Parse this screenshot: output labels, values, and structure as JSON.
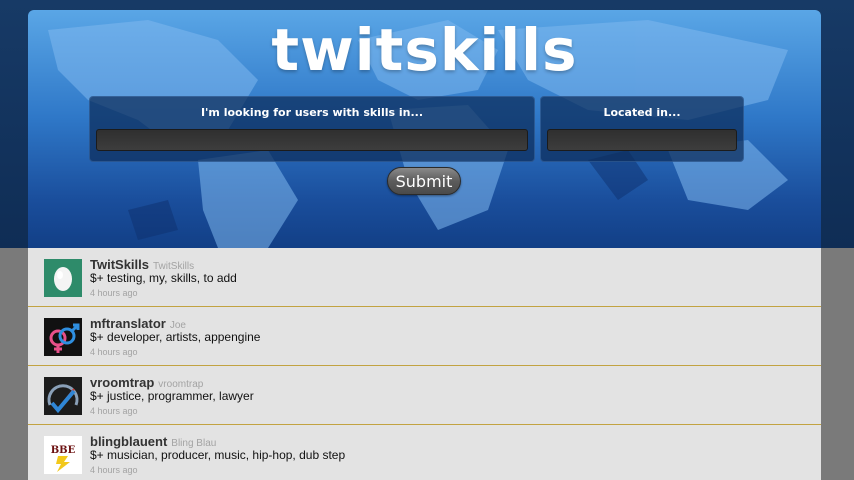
{
  "app": {
    "logo": "twitskills"
  },
  "search": {
    "skills_label": "I'm looking for users with skills in...",
    "skills_value": "",
    "location_label": "Located in...",
    "location_value": "",
    "submit_label": "Submit"
  },
  "feed": [
    {
      "username": "TwitSkills",
      "realname": "TwitSkills",
      "skills": "$+ testing, my, skills, to add",
      "time": "4 hours ago",
      "avatar": "egg-avatar-icon"
    },
    {
      "username": "mftranslator",
      "realname": "Joe",
      "skills": "$+ developer, artists, appengine",
      "time": "4 hours ago",
      "avatar": "gender-symbols-avatar-icon"
    },
    {
      "username": "vroomtrap",
      "realname": "vroomtrap",
      "skills": "$+ justice, programmer, lawyer",
      "time": "4 hours ago",
      "avatar": "speedometer-avatar-icon"
    },
    {
      "username": "blingblauent",
      "realname": "Bling Blau",
      "skills": "$+ musician, producer, music, hip-hop, dub step",
      "time": "4 hours ago",
      "avatar": "bbe-logo-avatar-icon",
      "avatar_text": "BBE"
    }
  ]
}
